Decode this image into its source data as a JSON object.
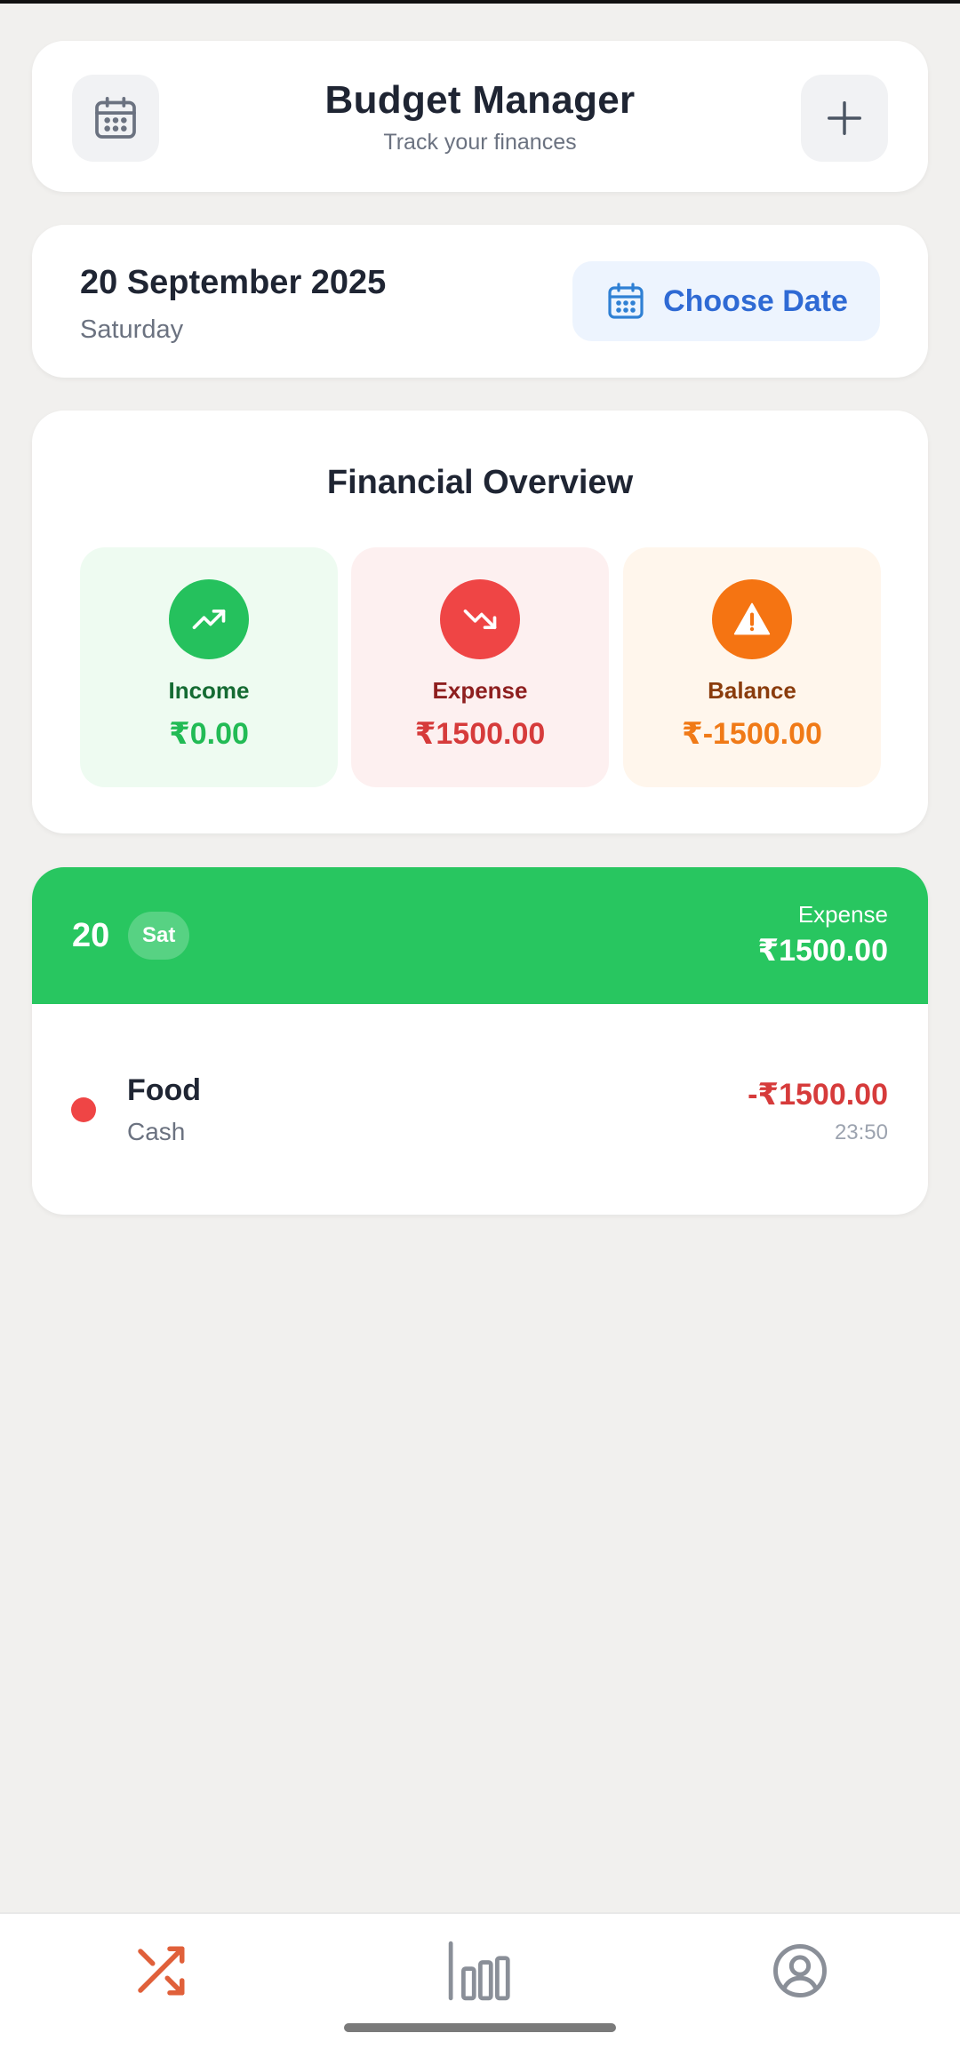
{
  "header": {
    "title": "Budget Manager",
    "subtitle": "Track your finances",
    "calendar_icon": "calendar-icon",
    "add_icon": "plus-icon"
  },
  "date_card": {
    "date": "20 September 2025",
    "weekday": "Saturday",
    "choose_label": "Choose Date"
  },
  "overview": {
    "title": "Financial Overview",
    "income": {
      "label": "Income",
      "amount": "₹0.00",
      "icon": "trending-up-icon",
      "color": "#25c15d"
    },
    "expense": {
      "label": "Expense",
      "amount": "₹1500.00",
      "icon": "trending-down-icon",
      "color": "#ef4545"
    },
    "balance": {
      "label": "Balance",
      "amount": "₹-1500.00",
      "icon": "warning-icon",
      "color": "#f57412"
    }
  },
  "day_group": {
    "day": "20",
    "weekday_short": "Sat",
    "expense_label": "Expense",
    "expense_amount": "₹1500.00",
    "header_color": "#28c660",
    "transactions": [
      {
        "category": "Food",
        "method": "Cash",
        "amount": "-₹1500.00",
        "time": "23:50"
      }
    ]
  },
  "bottom_nav": {
    "items": [
      {
        "icon": "shuffle-icon",
        "active": true,
        "color": "#e0603a"
      },
      {
        "icon": "bar-chart-icon",
        "active": false
      },
      {
        "icon": "profile-icon",
        "active": false
      }
    ]
  }
}
